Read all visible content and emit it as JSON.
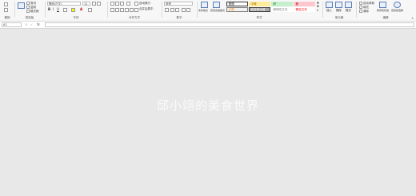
{
  "ribbon": {
    "groups": [
      {
        "id": "undo",
        "label": "撤销"
      },
      {
        "id": "clipboard",
        "label": "剪贴板",
        "items": [
          "剪切",
          "复制",
          "格式刷"
        ]
      },
      {
        "id": "font",
        "label": "字体",
        "font_name": "等线(正文)",
        "font_size": "11"
      },
      {
        "id": "alignment",
        "label": "对齐方式",
        "wrap": "自动换行",
        "merge": "合并后居中"
      },
      {
        "id": "number",
        "label": "数字",
        "format": "常规"
      },
      {
        "id": "styles",
        "label": "样式",
        "conditional": "条件格式",
        "table": "套用表格格式"
      },
      {
        "id": "cells",
        "label": "单元格",
        "insert": "插入",
        "delete": "删除",
        "format": "格式"
      },
      {
        "id": "editing",
        "label": "编辑",
        "sum": "自动求和",
        "fill": "填充",
        "clear": "清除",
        "sort": "排序和筛选",
        "find": "查找和选择"
      }
    ],
    "cell_styles": [
      {
        "label": "常规",
        "bg": "#ffffff",
        "fg": "#000000",
        "border": "#3c3c3c"
      },
      {
        "label": "中等",
        "bg": "#ffeb9c",
        "fg": "#9c6500",
        "border": "#ffeb9c"
      },
      {
        "label": "好",
        "bg": "#c6efce",
        "fg": "#006100",
        "border": "#c6efce"
      },
      {
        "label": "差",
        "bg": "#ffc7ce",
        "fg": "#9c0006",
        "border": "#ffc7ce"
      },
      {
        "label": "计算",
        "bg": "#f2f2f2",
        "fg": "#fa7d00",
        "border": "#7f7f7f"
      },
      {
        "label": "检查单元格",
        "bg": "#a5a5a5",
        "fg": "#ffffff",
        "border": "#3f3f3f"
      },
      {
        "label": "解释性文本",
        "bg": "#ffffff",
        "fg": "#7f7f7f",
        "border": "#ffffff"
      },
      {
        "label": "警告文本",
        "bg": "#ffffff",
        "fg": "#ff0000",
        "border": "#ffffff"
      }
    ]
  },
  "formula_bar": {
    "cell_ref": "A1",
    "fx": "fx",
    "content": ""
  },
  "watermark": "邱小翊的美食世界"
}
